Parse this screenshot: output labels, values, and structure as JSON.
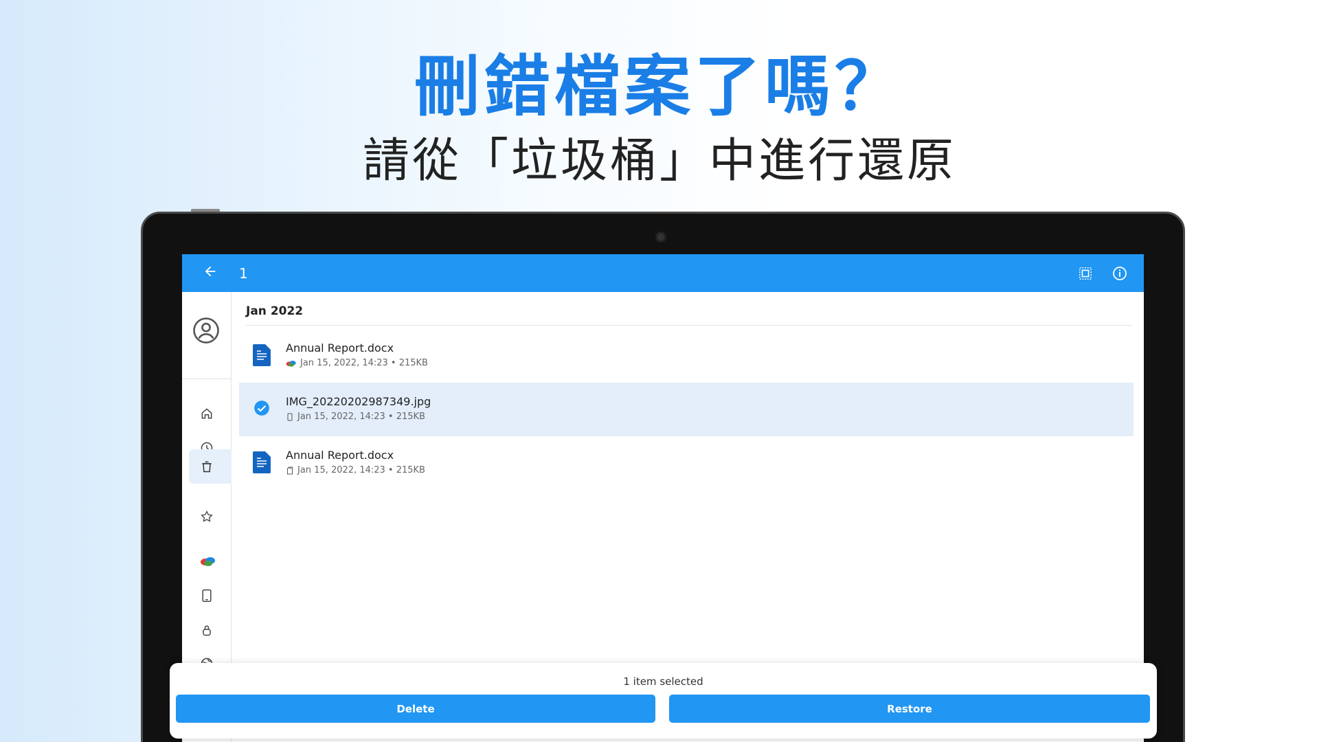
{
  "promo": {
    "headline": "刪錯檔案了嗎？",
    "subline": "請從「垃圾桶」中進行還原"
  },
  "appbar": {
    "back_icon": "arrow-back-icon",
    "selected_count": "1",
    "actions": [
      "select-all-icon",
      "info-icon"
    ]
  },
  "sidebar": {
    "items": [
      {
        "name": "home",
        "icon": "home-icon"
      },
      {
        "name": "recent",
        "icon": "clock-icon"
      },
      {
        "name": "trash",
        "icon": "trash-icon",
        "active": true
      },
      {
        "name": "favorites",
        "icon": "star-icon"
      },
      {
        "name": "cloud",
        "icon": "cloud-icon"
      },
      {
        "name": "device",
        "icon": "tablet-icon"
      },
      {
        "name": "secure",
        "icon": "lock-icon"
      },
      {
        "name": "network",
        "icon": "globe-icon"
      }
    ]
  },
  "content": {
    "section_title": "Jan 2022",
    "files": [
      {
        "name": "Annual Report.docx",
        "meta": "Jan 15, 2022, 14:23 • 215KB",
        "source": "cloud",
        "selected": false
      },
      {
        "name": "IMG_20220202987349.jpg",
        "meta": "Jan 15, 2022, 14:23 • 215KB",
        "source": "phone",
        "selected": true
      },
      {
        "name": "Annual Report.docx",
        "meta": "Jan 15, 2022, 14:23 • 215KB",
        "source": "sdcard",
        "selected": false
      }
    ]
  },
  "bottom": {
    "status": "1 item selected",
    "delete_label": "Delete",
    "restore_label": "Restore"
  },
  "colors": {
    "accent": "#2196f3",
    "headline": "#1a7ee6",
    "selected_row": "#e3eefa"
  }
}
